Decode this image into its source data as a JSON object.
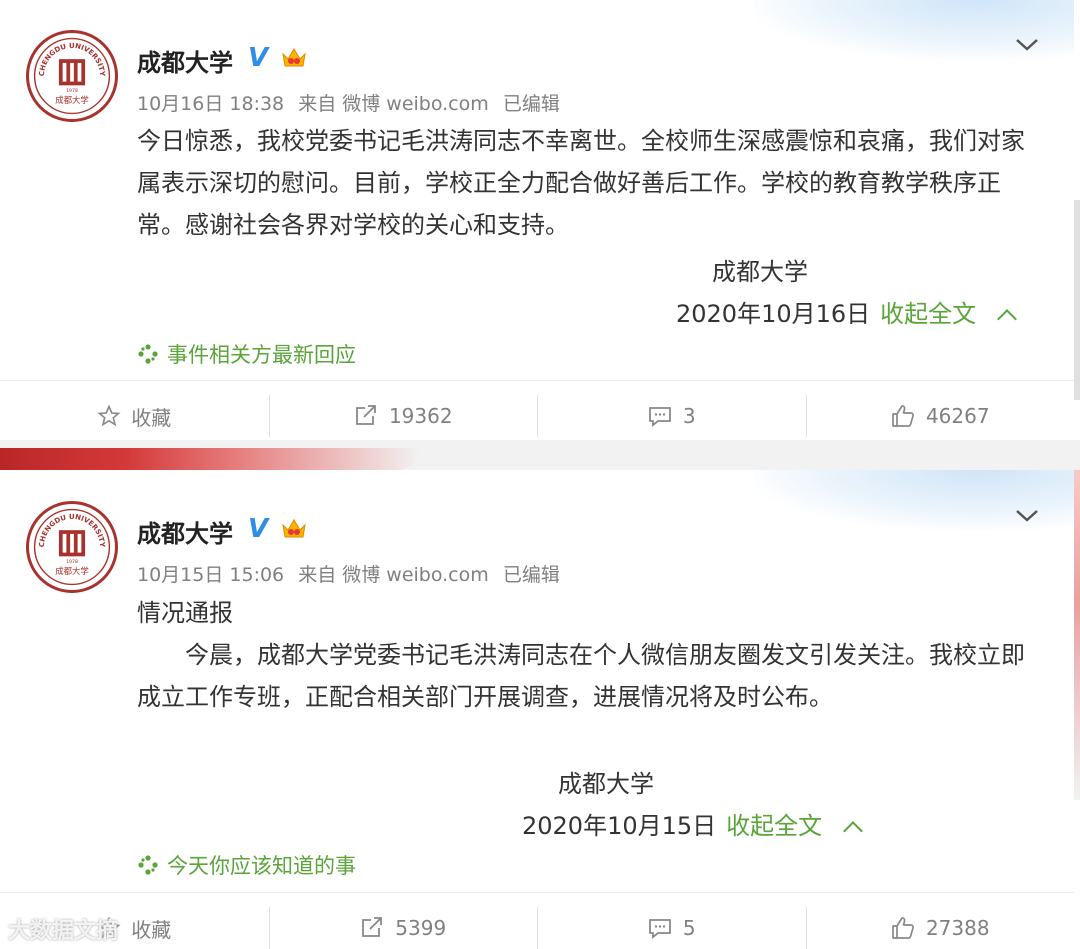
{
  "posts": [
    {
      "author": "成都大学",
      "time": "10月16日 18:38",
      "source": "来自 微博 weibo.com",
      "edited": "已编辑",
      "body": "今日惊悉，我校党委书记毛洪涛同志不幸离世。全校师生深感震惊和哀痛，我们对家属表示深切的慰问。目前，学校正全力配合做好善后工作。学校的教育教学秩序正常。感谢社会各界对学校的关心和支持。",
      "signature": "成都大学",
      "date": "2020年10月16日",
      "collapse": "收起全文",
      "topic": "事件相关方最新回应",
      "actions": {
        "favorite": "收藏",
        "repost": "19362",
        "comment": "3",
        "like": "46267"
      }
    },
    {
      "author": "成都大学",
      "time": "10月15日 15:06",
      "source": "来自 微博 weibo.com",
      "edited": "已编辑",
      "heading": "情况通报",
      "body": "今晨，成都大学党委书记毛洪涛同志在个人微信朋友圈发文引发关注。我校立即成立工作专班，正配合相关部门开展调查，进展情况将及时公布。",
      "signature": "成都大学",
      "date": "2020年10月15日",
      "collapse": "收起全文",
      "topic": "今天你应该知道的事",
      "actions": {
        "favorite": "收藏",
        "repost": "5399",
        "comment": "5",
        "like": "27388"
      }
    }
  ],
  "avatar_text": {
    "top": "CHENGDU UNIVERSITY",
    "year": "1978",
    "bottom": "成都大学"
  },
  "watermark": "大数据文摘",
  "colors": {
    "accent_green": "#5aa43a",
    "verified_blue": "#2f8ee8",
    "logo_red": "#a8322d",
    "meta_gray": "#808080"
  }
}
